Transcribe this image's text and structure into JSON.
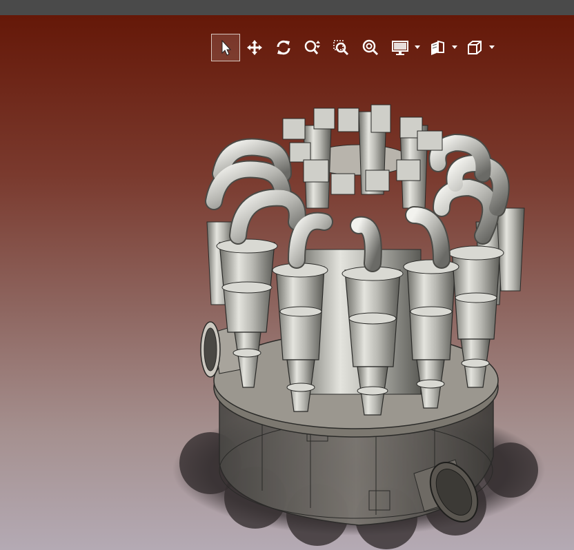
{
  "window": {
    "titlebar_color": "#4a4a4a"
  },
  "viewport": {
    "background_top": "#651808",
    "background_bottom": "#b4aab4"
  },
  "toolbar": {
    "tools": [
      {
        "name": "select",
        "icon": "cursor-arrow-icon",
        "active": true
      },
      {
        "name": "pan",
        "icon": "move-arrows-icon",
        "active": false
      },
      {
        "name": "rotate",
        "icon": "rotate-icon",
        "active": false
      },
      {
        "name": "zoom",
        "icon": "zoom-in-out-icon",
        "active": false
      },
      {
        "name": "zoom-window",
        "icon": "zoom-window-icon",
        "active": false
      },
      {
        "name": "zoom-fit",
        "icon": "zoom-fit-icon",
        "active": false
      },
      {
        "name": "display-mode",
        "icon": "monitor-icon",
        "dropdown": true
      },
      {
        "name": "section-view",
        "icon": "section-plane-icon",
        "dropdown": true
      },
      {
        "name": "view-orientation",
        "icon": "cube-view-icon",
        "dropdown": true
      }
    ]
  },
  "model": {
    "description_visible": false,
    "metal_color": "#c9c9c3",
    "shadow_color": "#3a3436"
  }
}
